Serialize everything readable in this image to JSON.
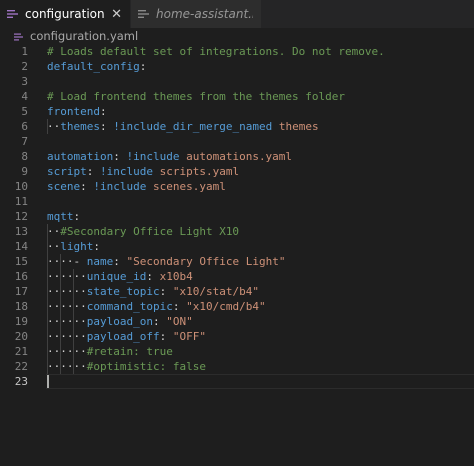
{
  "tabs": [
    {
      "label": "configuration.yaml",
      "close": "✕"
    },
    {
      "label": "home-assistant.log"
    }
  ],
  "breadcrumb": {
    "file": "configuration.yaml"
  },
  "editor": {
    "lines": [
      {
        "n": "1",
        "tokens": [
          {
            "t": "# Loads default set of integrations. Do not remove.",
            "c": "com"
          }
        ]
      },
      {
        "n": "2",
        "tokens": [
          {
            "t": "default_config",
            "c": "key"
          },
          {
            "t": ":",
            "c": "plain"
          }
        ]
      },
      {
        "n": "3",
        "tokens": []
      },
      {
        "n": "4",
        "tokens": [
          {
            "t": "# Load frontend themes from the themes folder",
            "c": "com"
          }
        ]
      },
      {
        "n": "5",
        "tokens": [
          {
            "t": "frontend",
            "c": "key"
          },
          {
            "t": ":",
            "c": "plain"
          }
        ]
      },
      {
        "n": "6",
        "tokens": [
          {
            "t": "··",
            "c": "ws"
          },
          {
            "t": "themes",
            "c": "key"
          },
          {
            "t": ": ",
            "c": "plain"
          },
          {
            "t": "!include_dir_merge_named",
            "c": "tag"
          },
          {
            "t": " themes",
            "c": "str"
          }
        ]
      },
      {
        "n": "7",
        "tokens": []
      },
      {
        "n": "8",
        "tokens": [
          {
            "t": "automation",
            "c": "key"
          },
          {
            "t": ": ",
            "c": "plain"
          },
          {
            "t": "!include",
            "c": "tag"
          },
          {
            "t": " automations.yaml",
            "c": "str"
          }
        ]
      },
      {
        "n": "9",
        "tokens": [
          {
            "t": "script",
            "c": "key"
          },
          {
            "t": ": ",
            "c": "plain"
          },
          {
            "t": "!include",
            "c": "tag"
          },
          {
            "t": " scripts.yaml",
            "c": "str"
          }
        ]
      },
      {
        "n": "10",
        "tokens": [
          {
            "t": "scene",
            "c": "key"
          },
          {
            "t": ": ",
            "c": "plain"
          },
          {
            "t": "!include",
            "c": "tag"
          },
          {
            "t": " scenes.yaml",
            "c": "str"
          }
        ]
      },
      {
        "n": "11",
        "tokens": []
      },
      {
        "n": "12",
        "tokens": [
          {
            "t": "mqtt",
            "c": "key"
          },
          {
            "t": ":",
            "c": "plain"
          }
        ]
      },
      {
        "n": "13",
        "tokens": [
          {
            "t": "··",
            "c": "ws"
          },
          {
            "t": "#Secondary Office Light X10",
            "c": "com"
          }
        ]
      },
      {
        "n": "14",
        "tokens": [
          {
            "t": "··",
            "c": "ws"
          },
          {
            "t": "light",
            "c": "key"
          },
          {
            "t": ":",
            "c": "plain"
          }
        ]
      },
      {
        "n": "15",
        "tokens": [
          {
            "t": "····",
            "c": "ws"
          },
          {
            "t": "- ",
            "c": "dash"
          },
          {
            "t": "name",
            "c": "key"
          },
          {
            "t": ": ",
            "c": "plain"
          },
          {
            "t": "\"Secondary Office Light\"",
            "c": "str"
          }
        ]
      },
      {
        "n": "16",
        "tokens": [
          {
            "t": "······",
            "c": "ws"
          },
          {
            "t": "unique_id",
            "c": "key"
          },
          {
            "t": ": ",
            "c": "plain"
          },
          {
            "t": "x10b4",
            "c": "str"
          }
        ]
      },
      {
        "n": "17",
        "tokens": [
          {
            "t": "······",
            "c": "ws"
          },
          {
            "t": "state_topic",
            "c": "key"
          },
          {
            "t": ": ",
            "c": "plain"
          },
          {
            "t": "\"x10/stat/b4\"",
            "c": "str"
          }
        ]
      },
      {
        "n": "18",
        "tokens": [
          {
            "t": "······",
            "c": "ws"
          },
          {
            "t": "command_topic",
            "c": "key"
          },
          {
            "t": ": ",
            "c": "plain"
          },
          {
            "t": "\"x10/cmd/b4\"",
            "c": "str"
          }
        ]
      },
      {
        "n": "19",
        "tokens": [
          {
            "t": "······",
            "c": "ws"
          },
          {
            "t": "payload_on",
            "c": "key"
          },
          {
            "t": ": ",
            "c": "plain"
          },
          {
            "t": "\"ON\"",
            "c": "str"
          }
        ]
      },
      {
        "n": "20",
        "tokens": [
          {
            "t": "······",
            "c": "ws"
          },
          {
            "t": "payload_off",
            "c": "key"
          },
          {
            "t": ": ",
            "c": "plain"
          },
          {
            "t": "\"OFF\"",
            "c": "str"
          }
        ]
      },
      {
        "n": "21",
        "tokens": [
          {
            "t": "······",
            "c": "ws"
          },
          {
            "t": "#retain: true",
            "c": "com"
          }
        ]
      },
      {
        "n": "22",
        "tokens": [
          {
            "t": "······",
            "c": "ws"
          },
          {
            "t": "#optimistic: false",
            "c": "com"
          }
        ]
      },
      {
        "n": "23",
        "tokens": []
      }
    ]
  }
}
